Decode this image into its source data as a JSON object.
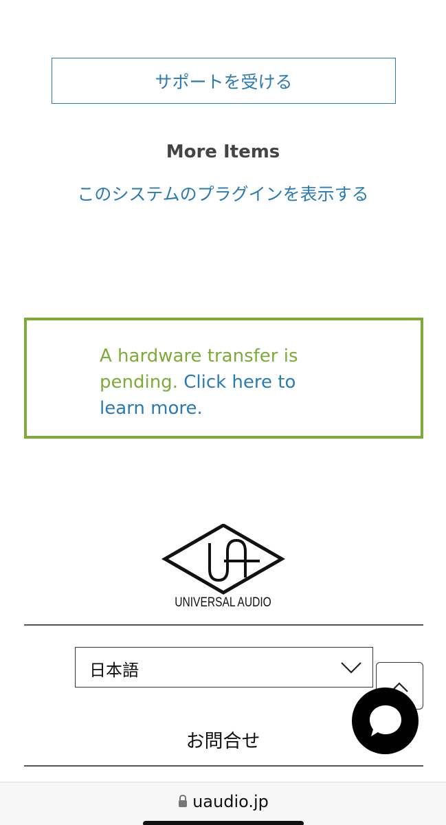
{
  "support": {
    "label": "サポートを受ける"
  },
  "more_items": {
    "heading": "More Items",
    "plugins_link": "このシステムのプラグインを表示する"
  },
  "notice": {
    "text": "A hardware transfer is pending.",
    "link_text": "Click here to learn more.",
    "border_color": "#7cab3a"
  },
  "logo": {
    "name": "UNIVERSAL AUDIO"
  },
  "language": {
    "selected": "日本語"
  },
  "contact": {
    "label": "お問合せ"
  },
  "browser": {
    "url": "uaudio.jp"
  },
  "colors": {
    "link": "#2b7bb0",
    "notice": "#7cab3a"
  }
}
